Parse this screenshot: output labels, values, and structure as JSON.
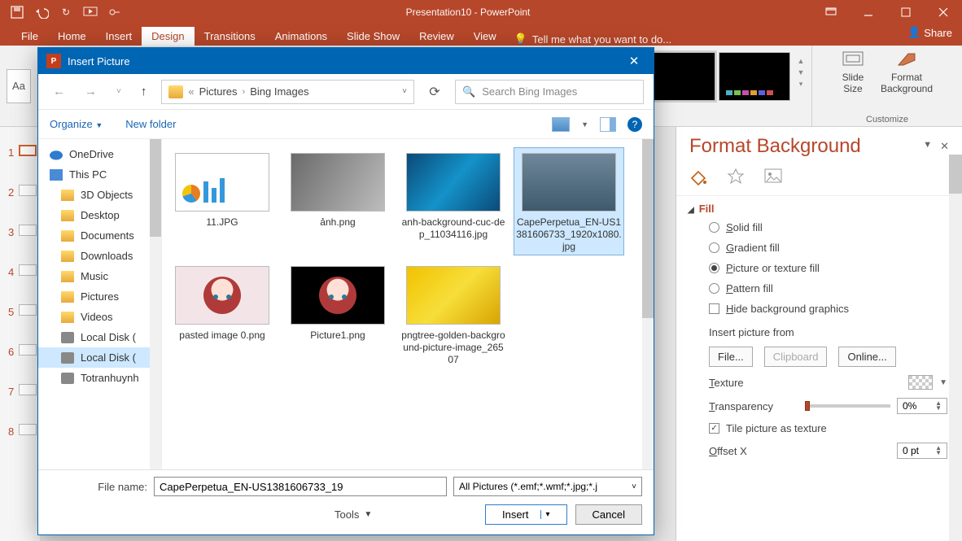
{
  "title": "Presentation10 - PowerPoint",
  "share": "Share",
  "ribbon_tabs": [
    "File",
    "Home",
    "Insert",
    "Design",
    "Transitions",
    "Animations",
    "Slide Show",
    "Review",
    "View"
  ],
  "active_tab": "Design",
  "tellme": "Tell me what you want to do...",
  "customize": {
    "slide_size": "Slide\nSize",
    "format_bg": "Format\nBackground",
    "group": "Customize"
  },
  "slides": [
    1,
    2,
    3,
    4,
    5,
    6,
    7,
    8
  ],
  "panel": {
    "title": "Format Background",
    "fill": "Fill",
    "solid": "Solid fill",
    "gradient": "Gradient fill",
    "picture": "Picture or texture fill",
    "pattern": "Pattern fill",
    "hide": "Hide background graphics",
    "insert_from": "Insert picture from",
    "file": "File...",
    "clipboard": "Clipboard",
    "online": "Online...",
    "texture": "Texture",
    "transparency": "Transparency",
    "transparency_val": "0%",
    "tile": "Tile picture as texture",
    "offsetx": "Offset X",
    "offsetx_val": "0 pt"
  },
  "dialog": {
    "title": "Insert Picture",
    "path": {
      "crumb1": "Pictures",
      "crumb2": "Bing Images"
    },
    "search_placeholder": "Search Bing Images",
    "organize": "Organize",
    "newfolder": "New folder",
    "tree": [
      {
        "label": "OneDrive",
        "icon": "cloud",
        "indent": false
      },
      {
        "label": "This PC",
        "icon": "pc",
        "indent": false
      },
      {
        "label": "3D Objects",
        "icon": "folder",
        "indent": true
      },
      {
        "label": "Desktop",
        "icon": "folder",
        "indent": true
      },
      {
        "label": "Documents",
        "icon": "folder",
        "indent": true
      },
      {
        "label": "Downloads",
        "icon": "folder",
        "indent": true
      },
      {
        "label": "Music",
        "icon": "folder",
        "indent": true
      },
      {
        "label": "Pictures",
        "icon": "folder",
        "indent": true
      },
      {
        "label": "Videos",
        "icon": "folder",
        "indent": true
      },
      {
        "label": "Local Disk (",
        "icon": "disk",
        "indent": true
      },
      {
        "label": "Local Disk (",
        "icon": "disk",
        "indent": true,
        "sel": true
      },
      {
        "label": "Totranhuynh",
        "icon": "disk",
        "indent": true
      }
    ],
    "files": [
      {
        "name": "11.JPG",
        "bg": "linear-gradient(#fff,#fff)",
        "extra": "chart"
      },
      {
        "name": "ảnh.png",
        "bg": "linear-gradient(120deg,#6a6a6a,#bdbdbd)"
      },
      {
        "name": "anh-background-cuc-dep_11034116.jpg",
        "bg": "linear-gradient(130deg,#0b4a78,#1492c9,#0b4a78)"
      },
      {
        "name": "CapePerpetua_EN-US1381606733_1920x1080.jpg",
        "bg": "linear-gradient(#6f8799,#3f5a6e)",
        "sel": true
      },
      {
        "name": "pasted image 0.png",
        "bg": "linear-gradient(#f3e5e7,#f3e5e7)",
        "extra": "chibi1"
      },
      {
        "name": "Picture1.png",
        "bg": "#000",
        "extra": "chibi2"
      },
      {
        "name": "pngtree-golden-background-picture-image_26507",
        "bg": "linear-gradient(135deg,#f2c200,#f7de3a,#d9a400)"
      }
    ],
    "filename_label": "File name:",
    "filename_value": "CapePerpetua_EN-US1381606733_19",
    "filetype": "All Pictures (*.emf;*.wmf;*.jpg;*.j",
    "tools": "Tools",
    "insert": "Insert",
    "cancel": "Cancel"
  }
}
